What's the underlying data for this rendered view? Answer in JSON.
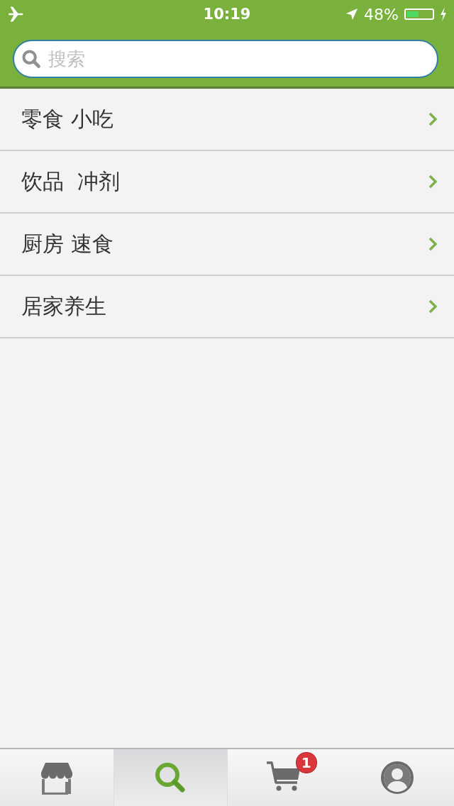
{
  "status_bar": {
    "time": "10:19",
    "battery_text": "48%",
    "battery": {
      "level": 0.48
    }
  },
  "search": {
    "placeholder": "搜索"
  },
  "categories": [
    {
      "label": "零食 小吃"
    },
    {
      "label": "饮品  冲剂"
    },
    {
      "label": "厨房 速食"
    },
    {
      "label": "居家养生"
    }
  ],
  "tab_bar": [
    {
      "kind": "store",
      "selected": false
    },
    {
      "kind": "search",
      "selected": true
    },
    {
      "kind": "cart",
      "selected": false,
      "badge": "1"
    },
    {
      "kind": "profile",
      "selected": false
    }
  ]
}
